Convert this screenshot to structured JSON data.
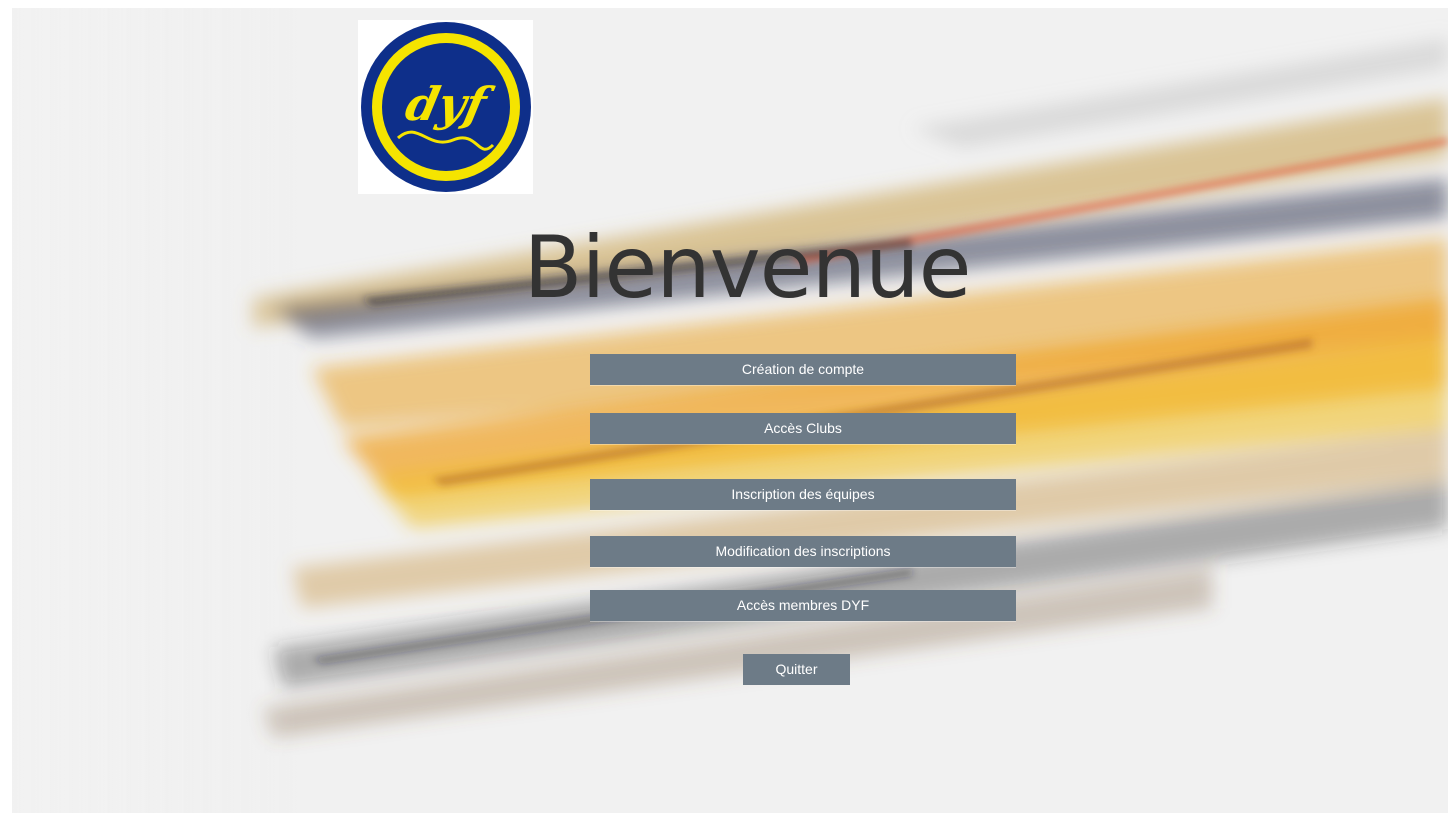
{
  "page": {
    "title": "Bienvenue",
    "colors": {
      "background": "#f1f1f1",
      "button": "#6d7b87",
      "button_text": "#ffffff",
      "title_text": "#333333",
      "logo_blue": "#0e2f8a",
      "logo_yellow": "#f5e400"
    }
  },
  "logo": {
    "icon": "dyf-logo-icon",
    "text": "dyf"
  },
  "menu": {
    "buttons": [
      {
        "label": "Création de compte"
      },
      {
        "label": "Accès Clubs"
      },
      {
        "label": "Inscription des équipes"
      },
      {
        "label": "Modification des inscriptions"
      },
      {
        "label": "Accès membres DYF"
      }
    ],
    "quit_label": "Quitter"
  }
}
